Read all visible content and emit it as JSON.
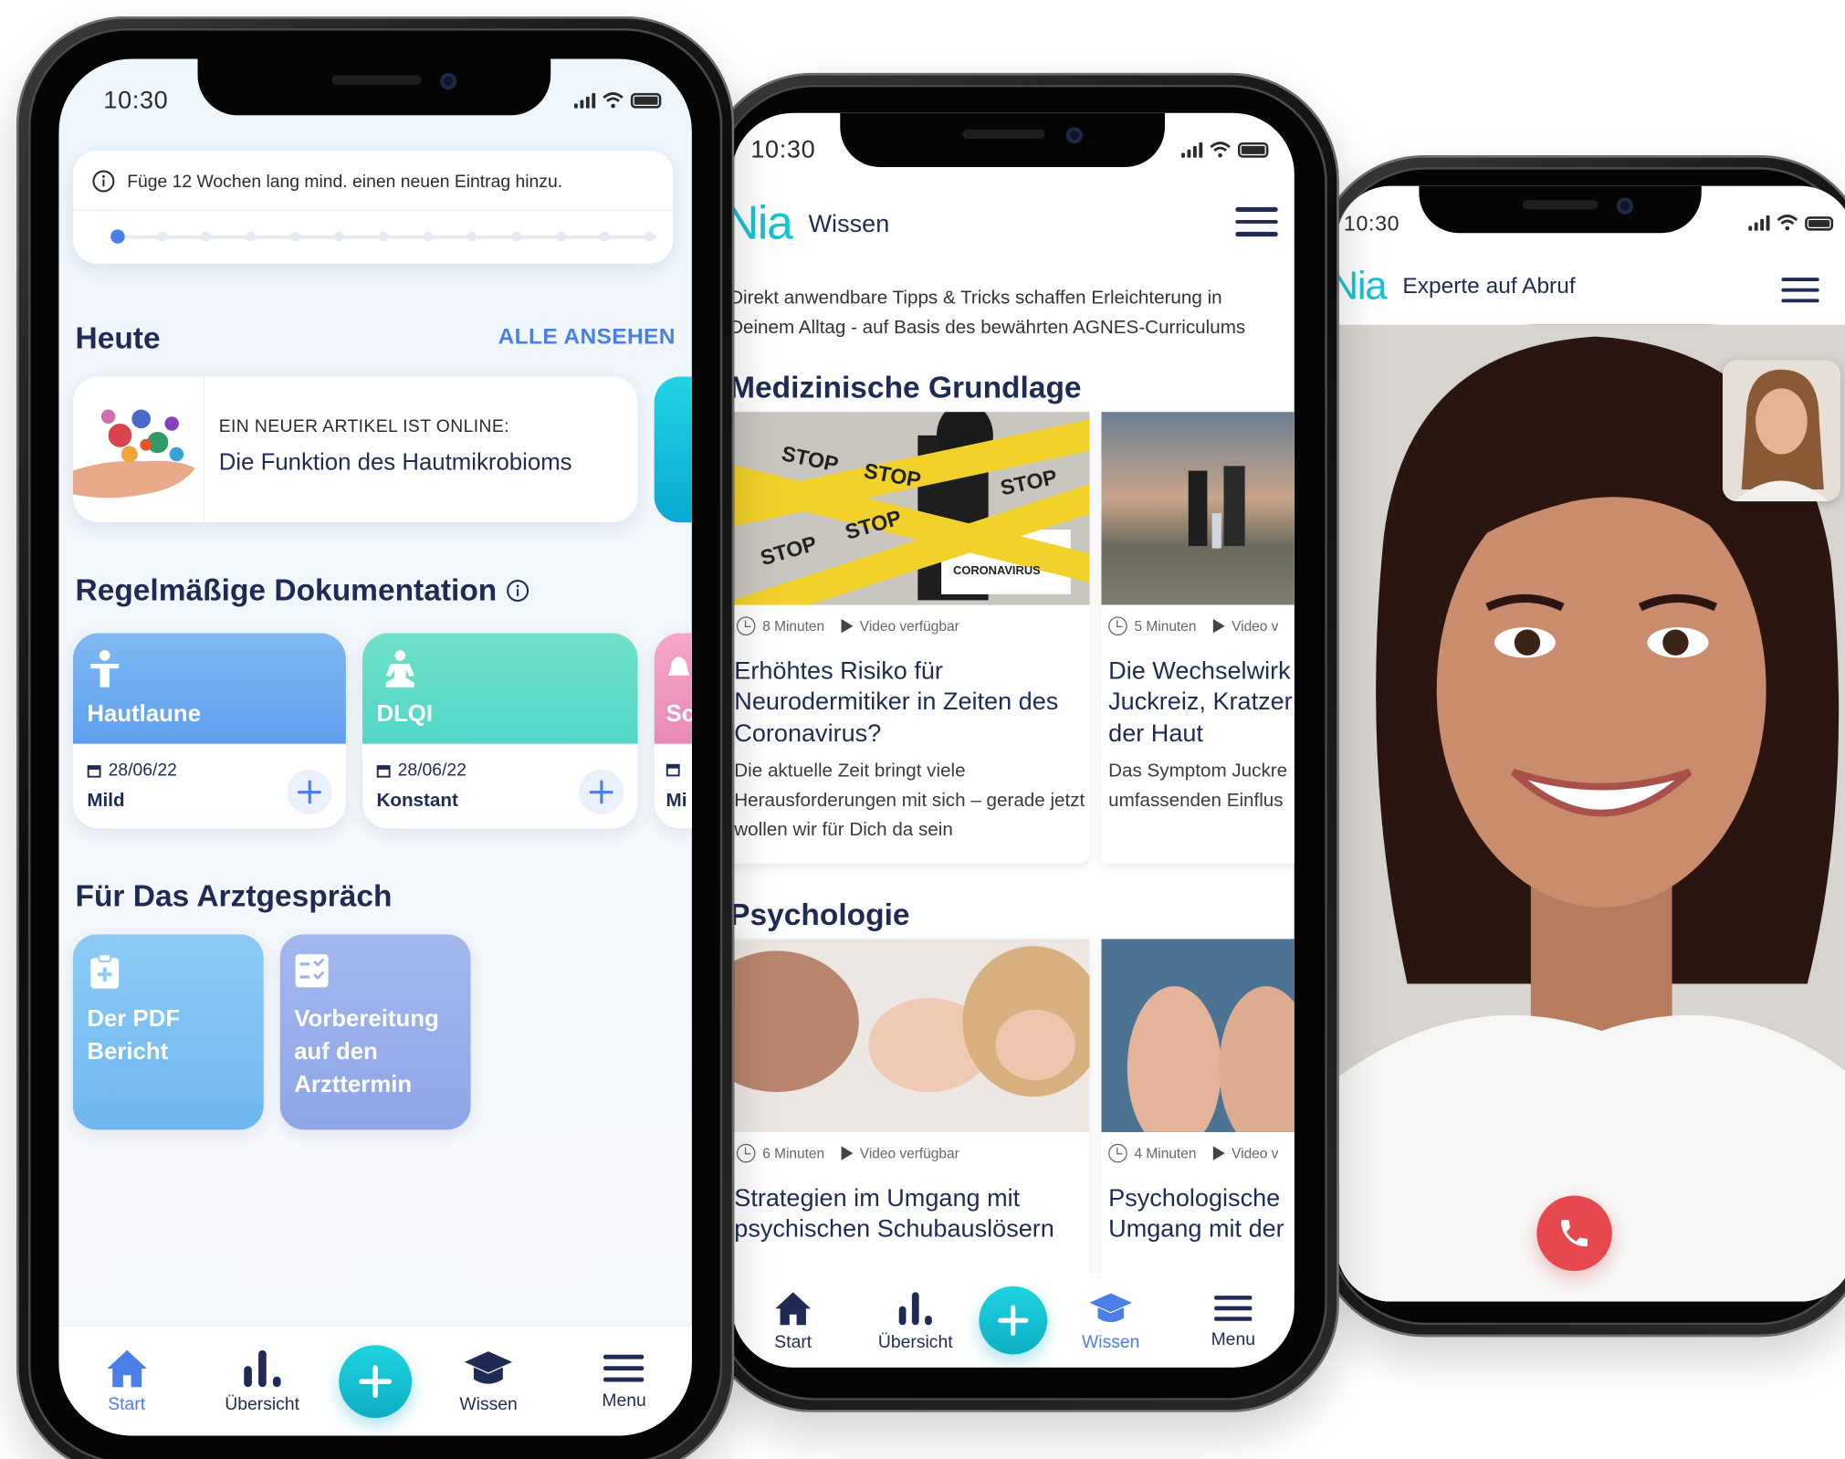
{
  "phone1": {
    "status": {
      "time": "10:30"
    },
    "banner": {
      "text": "Füge 12 Wochen lang mind. einen neuen Eintrag hinzu.",
      "info_icon": "info-icon",
      "progress_steps": 13,
      "progress_current": 1
    },
    "today": {
      "title": "Heute",
      "see_all": "ALLE ANSEHEN",
      "article": {
        "kicker": "EIN NEUER ARTIKEL IST ONLINE:",
        "title": "Die Funktion des Hautmikrobioms"
      }
    },
    "documentation": {
      "title": "Regelmäßige Dokumentation",
      "cards": [
        {
          "name": "Hautlaune",
          "date": "28/06/22",
          "value": "Mild",
          "icon": "person-icon",
          "color_top": "#7fb9f3",
          "color_bottom": "#5f9fee"
        },
        {
          "name": "DLQI",
          "date": "28/06/22",
          "value": "Konstant",
          "icon": "meditation-icon",
          "color_top": "#6fe0c8",
          "color_bottom": "#52d6c9"
        },
        {
          "name": "Sc",
          "date": "",
          "value": "Mi",
          "icon": "bell-icon",
          "color_top": "#f7a6c8",
          "color_bottom": "#e98ab6"
        }
      ]
    },
    "doctor": {
      "title": "Für Das Arztgespräch",
      "cards": [
        {
          "label": "Der PDF Bericht",
          "icon": "clipboard-plus-icon"
        },
        {
          "label": "Vorbereitung auf den Arzttermin",
          "icon": "checklist-icon"
        }
      ]
    },
    "nav": [
      {
        "label": "Start",
        "icon": "home-icon",
        "active": true
      },
      {
        "label": "Übersicht",
        "icon": "bar-chart-icon",
        "active": false
      },
      {
        "label": "",
        "icon": "plus-icon",
        "active": false
      },
      {
        "label": "Wissen",
        "icon": "graduation-cap-icon",
        "active": false
      },
      {
        "label": "Menu",
        "icon": "hamburger-icon",
        "active": false
      }
    ]
  },
  "phone2": {
    "status": {
      "time": "10:30"
    },
    "header": {
      "logo": "Nia",
      "title": "Wissen"
    },
    "intro": "Direkt anwendbare Tipps & Tricks schaffen Erleichterung in Deinem Alltag - auf Basis des bewährten AGNES-Curriculums",
    "sections": [
      {
        "title": "Medizinische Grundlage",
        "articles": [
          {
            "minutes": "8 Minuten",
            "video": "Video verfügbar",
            "title": "Erhöhtes Risiko für Neurodermitiker in Zeiten des Coronavirus?",
            "desc": "Die aktuelle Zeit bringt viele Herausforderungen mit sich – gerade jetzt wollen wir für Dich da sein",
            "image_text": "STOP",
            "image_sign": "CORONAVIRUS"
          },
          {
            "minutes": "5 Minuten",
            "video": "Video v",
            "title": "Die Wechselwirk Juckreiz, Kratzer der Haut",
            "desc": "Das Symptom Juckre umfassenden Einflus"
          }
        ]
      },
      {
        "title": "Psychologie",
        "articles": [
          {
            "minutes": "6 Minuten",
            "video": "Video verfügbar",
            "title": "Strategien im Umgang mit psychischen Schubauslösern",
            "desc": ""
          },
          {
            "minutes": "4 Minuten",
            "video": "Video v",
            "title": "Psychologische Umgang mit der",
            "desc": ""
          }
        ]
      }
    ],
    "nav": [
      {
        "label": "Start",
        "icon": "home-icon",
        "active": false
      },
      {
        "label": "Übersicht",
        "icon": "bar-chart-icon",
        "active": false
      },
      {
        "label": "",
        "icon": "plus-icon",
        "active": false
      },
      {
        "label": "Wissen",
        "icon": "graduation-cap-icon",
        "active": true
      },
      {
        "label": "Menu",
        "icon": "hamburger-icon",
        "active": false
      }
    ]
  },
  "phone3": {
    "status": {
      "time": "10:30"
    },
    "header": {
      "logo": "Nia",
      "title": "Experte auf Abruf"
    },
    "call": {
      "end_icon": "phone-hangup-icon",
      "end_color": "#e5484d"
    }
  },
  "colors": {
    "accent": "#4a7ee8",
    "navy": "#1f2b55",
    "teal": "#15c2d2"
  }
}
